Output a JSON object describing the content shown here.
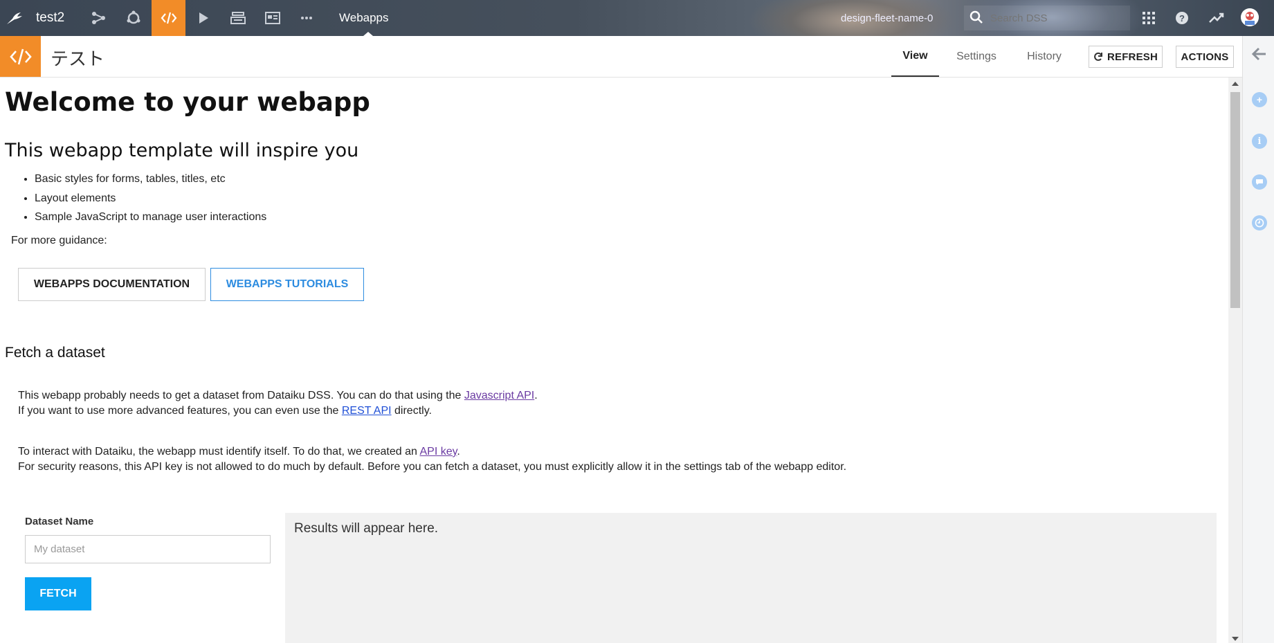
{
  "topnav": {
    "project_name": "test2",
    "section_label": "Webapps",
    "instance_name": "design-fleet-name-0",
    "search_placeholder": "Search DSS",
    "icons": [
      "bird-logo-icon",
      "flow-icon",
      "circle-cog-icon",
      "code-icon",
      "play-icon",
      "stack-icon",
      "dashboard-icon",
      "more-icon"
    ]
  },
  "header": {
    "title": "テスト",
    "tabs": [
      {
        "label": "View",
        "active": true
      },
      {
        "label": "Settings",
        "active": false
      },
      {
        "label": "History",
        "active": false
      }
    ],
    "refresh_label": "REFRESH",
    "actions_label": "ACTIONS"
  },
  "content": {
    "heading": "Welcome to your webapp",
    "subheading": "This webapp template will inspire you",
    "features": [
      "Basic styles for forms, tables, titles, etc",
      "Layout elements",
      "Sample JavaScript to manage user interactions"
    ],
    "guidance_label": "For more guidance:",
    "doc_button": "WEBAPPS DOCUMENTATION",
    "tutorial_button": "WEBAPPS TUTORIALS",
    "fetch_heading": "Fetch a dataset",
    "p1_a": "This webapp probably needs to get a dataset from Dataiku DSS. You can do that using the ",
    "p1_link": "Javascript API",
    "p1_b": ".",
    "p2_a": "If you want to use more advanced features, you can even use the ",
    "p2_link": "REST API",
    "p2_b": " directly.",
    "p3_a": "To interact with Dataiku, the webapp must identify itself. To do that, we created an ",
    "p3_link": "API key",
    "p3_b": ".",
    "p4": "For security reasons, this API key is not allowed to do much by default. Before you can fetch a dataset, you must explicitly allow it in the settings tab of the webapp editor.",
    "dataset_label": "Dataset Name",
    "dataset_placeholder": "My dataset",
    "fetch_button": "FETCH",
    "results_text": "Results will appear here."
  },
  "colors": {
    "accent_orange": "#f28c28",
    "fetch_blue": "#0aa3f2",
    "tutorial_blue": "#2d8ce0",
    "rail_icon_blue": "#a7cdf5"
  }
}
